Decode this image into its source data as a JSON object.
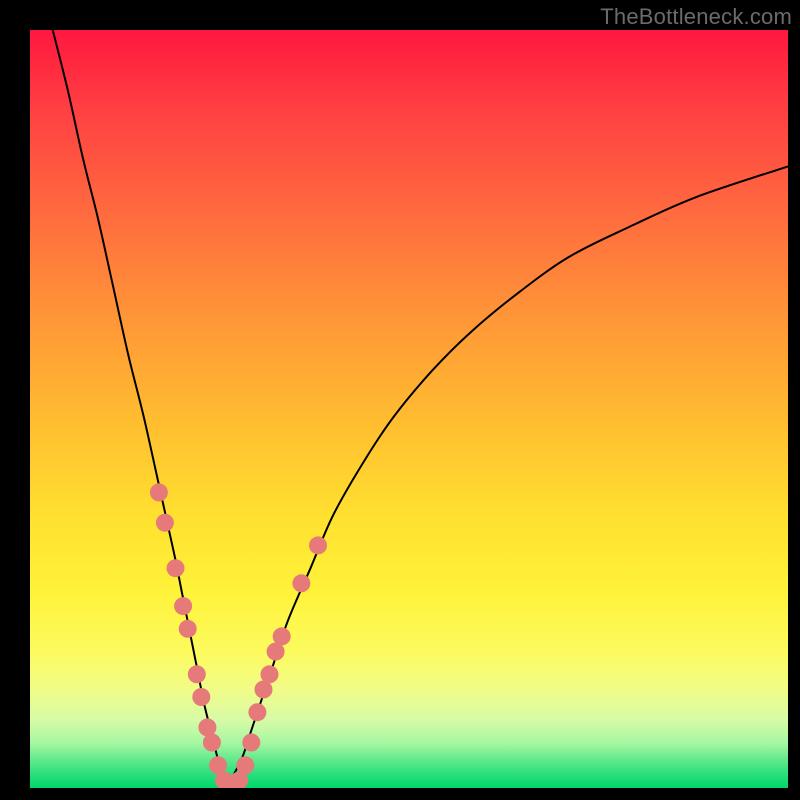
{
  "watermark": "TheBottleneck.com",
  "colors": {
    "curve": "#000000",
    "marker_fill": "#e67a7a",
    "marker_stroke": "#d46464"
  },
  "chart_data": {
    "type": "line",
    "title": "",
    "xlabel": "",
    "ylabel": "",
    "xlim": [
      0,
      100
    ],
    "ylim": [
      0,
      100
    ],
    "grid": false,
    "legend": false,
    "series": [
      {
        "name": "left-branch",
        "x": [
          3,
          5,
          7,
          9,
          11,
          13,
          15,
          17,
          19,
          20,
          21,
          22,
          23,
          24,
          25,
          26
        ],
        "y": [
          100,
          92,
          83,
          75,
          66,
          57,
          49,
          40,
          31,
          26,
          21,
          16,
          11,
          7,
          3,
          0
        ]
      },
      {
        "name": "right-branch",
        "x": [
          26,
          27,
          28,
          29,
          30,
          32,
          34,
          37,
          40,
          44,
          48,
          53,
          58,
          64,
          71,
          79,
          88,
          100
        ],
        "y": [
          0,
          2,
          4,
          7,
          10,
          16,
          22,
          29,
          36,
          43,
          49,
          55,
          60,
          65,
          70,
          74,
          78,
          82
        ]
      }
    ],
    "markers": [
      {
        "x": 17.0,
        "y": 39
      },
      {
        "x": 17.8,
        "y": 35
      },
      {
        "x": 19.2,
        "y": 29
      },
      {
        "x": 20.2,
        "y": 24
      },
      {
        "x": 20.8,
        "y": 21
      },
      {
        "x": 22.0,
        "y": 15
      },
      {
        "x": 22.6,
        "y": 12
      },
      {
        "x": 23.4,
        "y": 8
      },
      {
        "x": 24.0,
        "y": 6
      },
      {
        "x": 24.8,
        "y": 3
      },
      {
        "x": 25.6,
        "y": 1
      },
      {
        "x": 26.6,
        "y": 0
      },
      {
        "x": 27.6,
        "y": 1
      },
      {
        "x": 28.4,
        "y": 3
      },
      {
        "x": 29.2,
        "y": 6
      },
      {
        "x": 30.0,
        "y": 10
      },
      {
        "x": 30.8,
        "y": 13
      },
      {
        "x": 31.6,
        "y": 15
      },
      {
        "x": 32.4,
        "y": 18
      },
      {
        "x": 33.2,
        "y": 20
      },
      {
        "x": 35.8,
        "y": 27
      },
      {
        "x": 38.0,
        "y": 32
      }
    ],
    "annotations": []
  }
}
